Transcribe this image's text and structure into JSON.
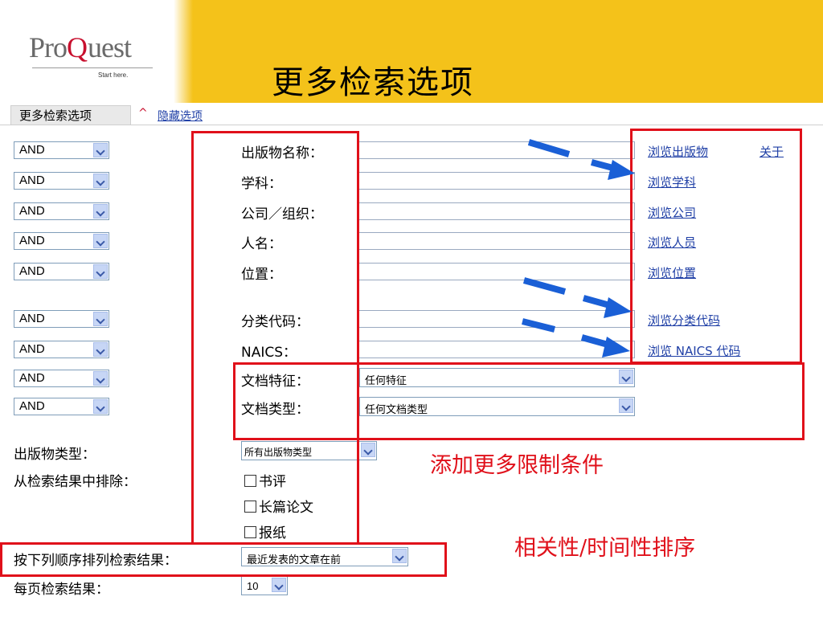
{
  "header": {
    "title": "更多检索选项",
    "logo": {
      "pro": "Pro",
      "q": "Q",
      "rest": "uest",
      "tagline": "Start here."
    },
    "bar_color": "#f4c21a"
  },
  "tabs": {
    "active_label": "更多检索选项",
    "hide_link": "隐藏选项"
  },
  "operators": [
    "AND",
    "AND",
    "AND",
    "AND",
    "AND",
    "AND",
    "AND",
    "AND",
    "AND"
  ],
  "fields": [
    {
      "label": "出版物名称：",
      "browse": "浏览出版物",
      "extra": "关于"
    },
    {
      "label": "学科：",
      "browse": "浏览学科"
    },
    {
      "label": "公司／组织：",
      "browse": "浏览公司"
    },
    {
      "label": "人名：",
      "browse": "浏览人员"
    },
    {
      "label": "位置：",
      "browse": "浏览位置"
    },
    {
      "label": "分类代码：",
      "browse": "浏览分类代码"
    },
    {
      "label": "NAICS：",
      "browse": "浏览 NAICS 代码"
    }
  ],
  "doc_filters": [
    {
      "label": "文档特征：",
      "value": "任何特征"
    },
    {
      "label": "文档类型：",
      "value": "任何文档类型"
    }
  ],
  "publication_type": {
    "label": "出版物类型：",
    "value": "所有出版物类型"
  },
  "exclude": {
    "label": "从检索结果中排除：",
    "options": [
      "书评",
      "长篇论文",
      "报纸"
    ]
  },
  "sort": {
    "label": "按下列顺序排列检索结果：",
    "value": "最近发表的文章在前"
  },
  "per_page": {
    "label": "每页检索结果：",
    "value": "10"
  },
  "annotations": {
    "more_limits": "添加更多限制条件",
    "sort_note": "相关性/时间性排序",
    "color": "#e0101a",
    "arrow_color": "#1a5fd6"
  }
}
